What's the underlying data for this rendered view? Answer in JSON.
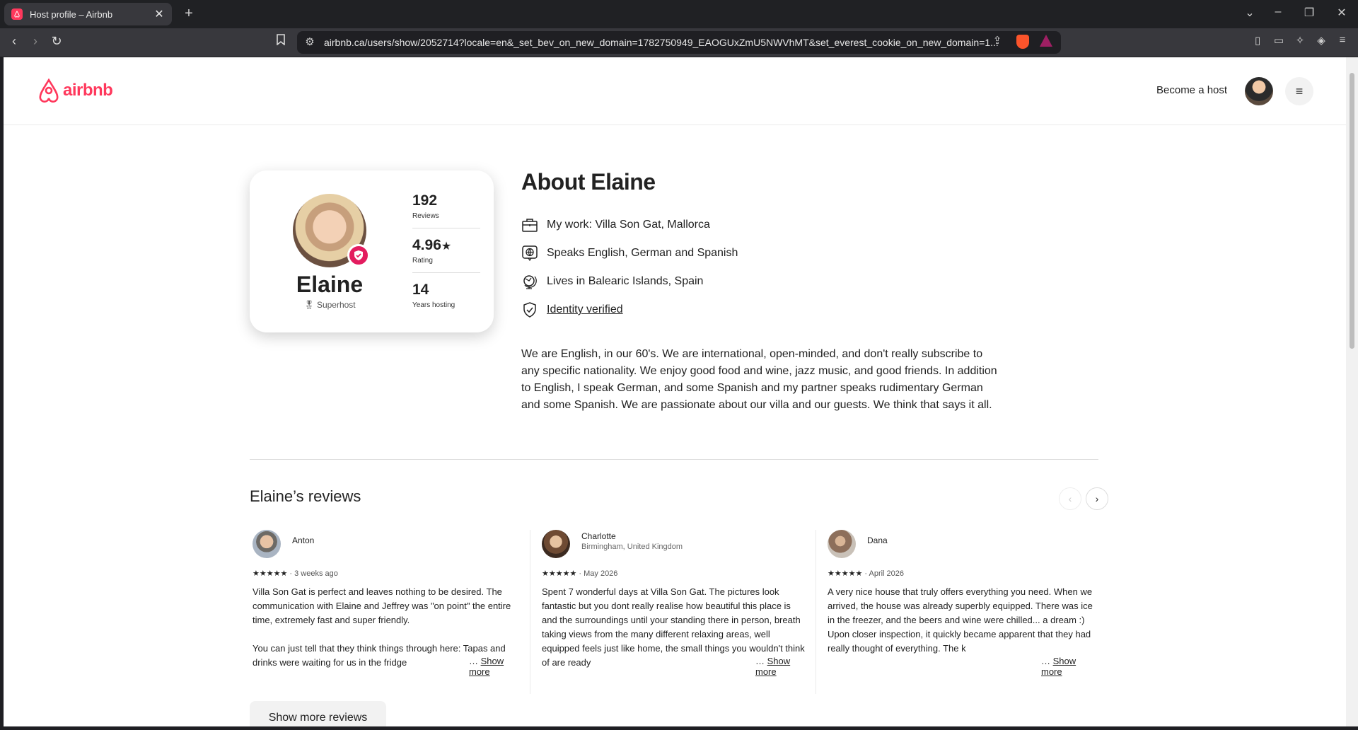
{
  "browser": {
    "tab_title": "Host profile – Airbnb",
    "url": "airbnb.ca/users/show/2052714?locale=en&_set_bev_on_new_domain=1782750949_EAOGUxZmU5NWVhMT&set_everest_cookie_on_new_domain=1..."
  },
  "header": {
    "logo_text": "airbnb",
    "become_host": "Become a host",
    "brand_color": "#FF385C"
  },
  "profile": {
    "name": "Elaine",
    "role": "Superhost",
    "stats": [
      {
        "value": "192",
        "label": "Reviews"
      },
      {
        "value": "4.96",
        "label": "Rating"
      },
      {
        "value": "14",
        "label": "Years hosting"
      }
    ]
  },
  "about": {
    "title": "About Elaine",
    "work": "My work: Villa Son Gat, Mallorca",
    "languages": "Speaks English, German and Spanish",
    "lives": "Lives in Balearic Islands, Spain",
    "identity": "Identity verified",
    "bio": "We are English, in our 60's. We are international, open-minded, and don't really subscribe to any specific nationality. We enjoy good food and wine, jazz music, and good friends. In addition to English, I speak German, and some Spanish and my partner speaks rudimentary German and some Spanish. We are passionate about our villa and our guests. We think that says it all."
  },
  "reviews": {
    "title": "Elaine’s reviews",
    "show_more_label": "Show more",
    "show_more_reviews": "Show more reviews",
    "items": [
      {
        "name": "Anton",
        "location": "",
        "stars": "★★★★★",
        "date": "3 weeks ago",
        "text": "Villa Son Gat is perfect and leaves nothing to be desired. The communication with Elaine and Jeffrey was \"on point\" the entire time, extremely fast and super friendly.\n\nYou can just tell that they think things through here: Tapas and drinks were waiting for us in the fridge"
      },
      {
        "name": "Charlotte",
        "location": "Birmingham, United Kingdom",
        "stars": "★★★★★",
        "date": "May 2026",
        "text": "Spent 7 wonderful days at Villa Son Gat. The pictures look fantastic but you dont really realise how beautiful this place is and the surroundings until your standing there in person, breath taking views from the many different relaxing areas, well equipped feels just like home, the small things you wouldn't think of are ready"
      },
      {
        "name": "Dana",
        "location": "",
        "stars": "★★★★★",
        "date": "April 2026",
        "text": "A very nice house that truly offers everything you need. When we arrived, the house was already superbly equipped. There was ice in the freezer, and the beers and wine were chilled... a dream :)\nUpon closer inspection, it quickly became apparent that they had really thought of everything. The k"
      }
    ]
  }
}
